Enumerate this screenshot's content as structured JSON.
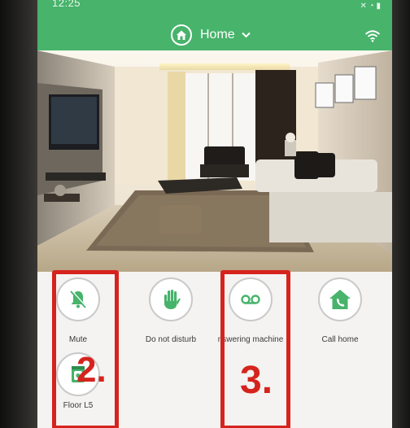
{
  "status_bar": {
    "time": "12:25",
    "icons": "✕ ◔ ▮"
  },
  "header": {
    "title": "Home",
    "title_icon": "home-icon",
    "dropdown_icon": "chevron-down-icon",
    "right_icon": "wifi-icon"
  },
  "colors": {
    "brand_green": "#47b36b",
    "annotation_red": "#d6231d",
    "panel_bg": "#f4f3f1"
  },
  "actions": [
    {
      "label": "Mute",
      "icon": "bell-slash-icon"
    },
    {
      "label": "Do not disturb",
      "icon": "hand-icon"
    },
    {
      "label": "nswering machine",
      "icon": "voicemail-icon"
    },
    {
      "label": "Call home",
      "icon": "house-phone-icon"
    },
    {
      "label": "Floor L5",
      "icon": "door-camera-icon"
    }
  ],
  "annotations": {
    "mark_2": "2.",
    "mark_3": "3."
  }
}
